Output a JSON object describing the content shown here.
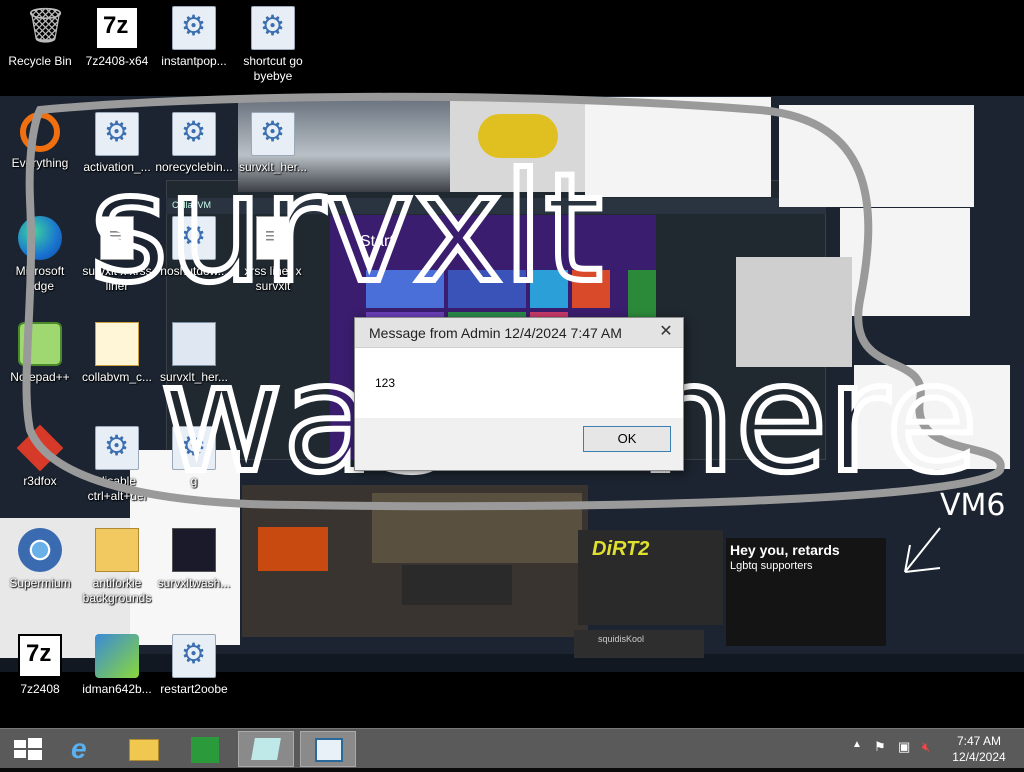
{
  "desktop_icons": [
    {
      "label": "Recycle Bin",
      "icon": "recycle-bin-icon"
    },
    {
      "label": "7z2408-x64",
      "icon": "7zip-installer-icon"
    },
    {
      "label": "instantpop...",
      "icon": "batch-file-icon"
    },
    {
      "label": "shortcut go byebye",
      "icon": "batch-file-icon"
    },
    {
      "label": "Everything",
      "icon": "everything-icon"
    },
    {
      "label": "activation_...",
      "icon": "batch-file-icon"
    },
    {
      "label": "norecyclebin...",
      "icon": "batch-file-icon"
    },
    {
      "label": "survxlt_her...",
      "icon": "batch-file-icon"
    },
    {
      "label": "Microsoft Edge",
      "icon": "edge-icon"
    },
    {
      "label": "survxlt x xrss liner",
      "icon": "text-file-icon"
    },
    {
      "label": "noshutdow...",
      "icon": "batch-file-icon"
    },
    {
      "label": "xrss liner x survxlt",
      "icon": "text-file-icon"
    },
    {
      "label": "Notepad++",
      "icon": "notepadpp-icon"
    },
    {
      "label": "collabvm_c...",
      "icon": "certificate-icon"
    },
    {
      "label": "survxlt_her...",
      "icon": "window-icon"
    },
    {
      "label": "r3dfox",
      "icon": "r3dfox-icon"
    },
    {
      "label": "disable ctrl+alt+del",
      "icon": "batch-file-icon"
    },
    {
      "label": "g",
      "icon": "batch-file-icon"
    },
    {
      "label": "Supermium",
      "icon": "supermium-icon"
    },
    {
      "label": "antiforkie backgrounds",
      "icon": "zip-folder-icon"
    },
    {
      "label": "survxltwash...",
      "icon": "image-file-icon"
    },
    {
      "label": "7z2408",
      "icon": "7zip-icon"
    },
    {
      "label": "idman642b...",
      "icon": "installer-icon"
    },
    {
      "label": "restart2oobe",
      "icon": "batch-file-icon"
    }
  ],
  "graffiti": {
    "word1": "survxlt",
    "word2": "was",
    "word3": "here",
    "tag": "VM6"
  },
  "wallpaper_text": {
    "start_title": "Start",
    "collab_title": "CollabVM",
    "meme_title": "Hey you, retards",
    "meme_sub": "Lgbtq supporters",
    "dirt_logo": "DiRT2",
    "chat_line": "squidisKool"
  },
  "message_box": {
    "title": "Message from Admin 12/4/2024 7:47 AM",
    "body": "123",
    "ok_label": "OK"
  },
  "taskbar": {
    "time": "7:47 AM",
    "date": "12/4/2024",
    "pinned": [
      "start-button",
      "internet-explorer",
      "file-explorer",
      "windows-store",
      "active-app-1",
      "active-app-2"
    ]
  },
  "colors": {
    "taskbar_bg": "#5a5a5a",
    "scribble_white": "#ffffff",
    "scribble_gray": "#9a9a9a",
    "start_purple": "#3a1d6e"
  }
}
